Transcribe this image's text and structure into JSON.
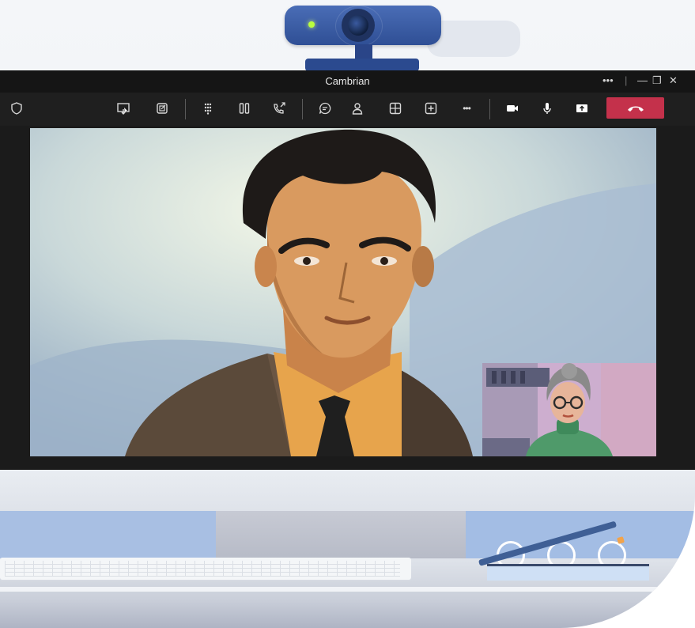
{
  "window": {
    "title": "Cambrian",
    "more_glyph": "•••",
    "minimize_glyph": "—",
    "restore_glyph": "❐",
    "close_glyph": "✕"
  },
  "toolbar": {
    "left_icon": "shield-icon",
    "items": [
      {
        "icon": "share-screen-icon"
      },
      {
        "icon": "popout-icon"
      },
      {
        "icon": "dialpad-icon"
      },
      {
        "icon": "hold-icon"
      },
      {
        "icon": "transfer-call-icon"
      },
      {
        "icon": "chat-icon"
      },
      {
        "icon": "people-icon"
      },
      {
        "icon": "view-layout-icon"
      },
      {
        "icon": "apps-add-icon"
      },
      {
        "icon": "more-icon",
        "glyph": "•••"
      },
      {
        "icon": "camera-icon"
      },
      {
        "icon": "mic-icon"
      },
      {
        "icon": "share-tray-icon"
      },
      {
        "icon": "hang-up-icon"
      }
    ],
    "hangup_color": "#c4314b"
  },
  "video": {
    "main_participant": "man-in-suit-video",
    "self_view": "woman-with-glasses-video"
  },
  "colors": {
    "accent_blue": "#2f4f95",
    "window_bg": "#1b1b1b",
    "toolbar_bg": "#1f1f1f"
  }
}
